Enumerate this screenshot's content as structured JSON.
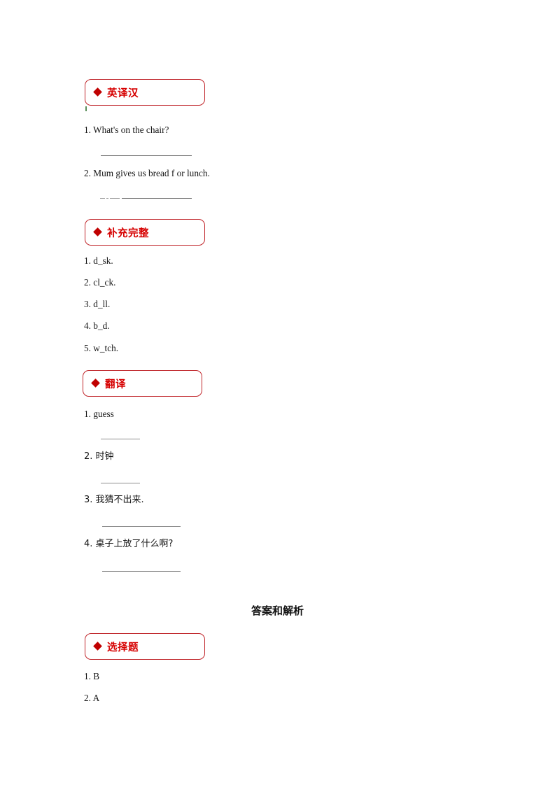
{
  "document": {
    "answer_heading": "答案和解析",
    "accent_color": "#d60000",
    "border_color": "#c0252a",
    "bullet_color": "#c00000"
  },
  "sections": [
    {
      "id": "en-to-cn",
      "title": "英译汉",
      "bullet": "diamond-icon",
      "items": [
        {
          "text": "1. What's on the chair?",
          "blank": "plain"
        },
        {
          "text": "2. Mum gives us bread f or lunch.",
          "blank": "dashed"
        }
      ]
    },
    {
      "id": "fill-complete",
      "title": "补充完整",
      "bullet": "diamond-icon",
      "items": [
        {
          "text": "1.  d_sk."
        },
        {
          "text": "2. cl_ck."
        },
        {
          "text": "3. d_ll."
        },
        {
          "text": "4. b_d."
        },
        {
          "text": "5. w_tch."
        }
      ]
    },
    {
      "id": "translate",
      "title": "翻译",
      "bullet": "diamond-icon",
      "items": [
        {
          "text": "1. guess",
          "blank": "short"
        },
        {
          "text": "2. 时钟",
          "blank": "short"
        },
        {
          "text": "3. 我猜不出来.",
          "blank": "medium"
        },
        {
          "text": "4. 桌子上放了什么啊?",
          "blank": "medium"
        }
      ]
    },
    {
      "id": "multiple-choice-answers",
      "title": "选择题",
      "bullet": "diamond-icon",
      "items": [
        {
          "text": "1. B"
        },
        {
          "text": "2. A"
        }
      ]
    }
  ]
}
